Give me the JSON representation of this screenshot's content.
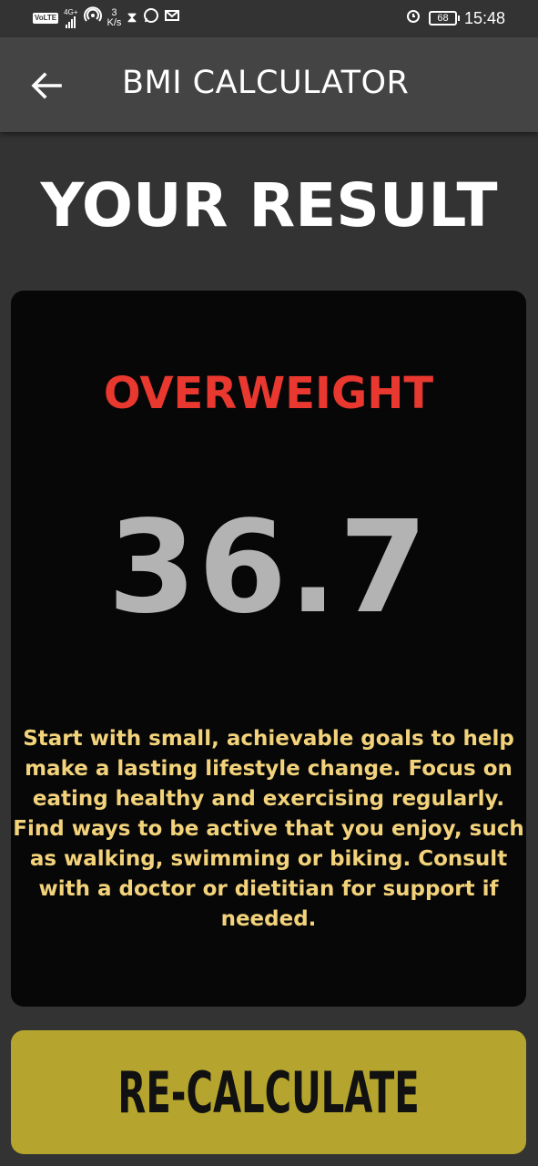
{
  "status_bar": {
    "volte": "VoLTE",
    "network_type": "4G+",
    "speed_value": "3",
    "speed_unit": "K/s",
    "battery": "68",
    "time": "15:48",
    "icons": [
      "volte-icon",
      "signal-icon",
      "hotspot-icon",
      "hourglass-icon",
      "whatsapp-icon",
      "message-icon",
      "alarm-icon",
      "battery-icon"
    ]
  },
  "app_bar": {
    "back_icon": "arrow-left-icon",
    "title": "BMI CALCULATOR"
  },
  "result": {
    "heading": "YOUR RESULT",
    "category": "OVERWEIGHT",
    "bmi": "36.7",
    "advice": "Start with small, achievable goals to help make a lasting lifestyle change. Focus on eating healthy and exercising regularly. Find ways to be active that you enjoy, such as walking, swimming or biking. Consult with a doctor or dietitian for support if needed."
  },
  "action": {
    "recalculate_label": "RE-CALCULATE"
  },
  "colors": {
    "background": "#333333",
    "app_bar": "#444444",
    "card": "#070707",
    "category": "#e8382f",
    "bmi": "#b3b3b3",
    "advice": "#f2d27a",
    "button": "#b5a52e"
  }
}
